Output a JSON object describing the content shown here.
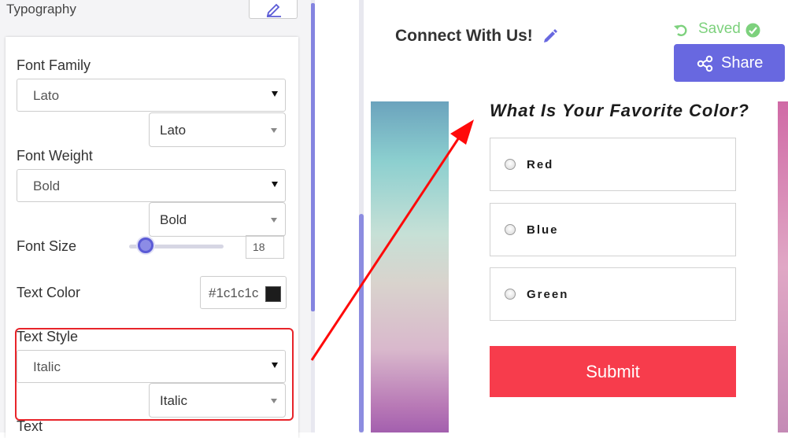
{
  "sidebar": {
    "section_title": "Typography",
    "font_family": {
      "label": "Font Family",
      "value": "Lato",
      "sub_value": "Lato"
    },
    "font_weight": {
      "label": "Font Weight",
      "value": "Bold",
      "sub_value": "Bold"
    },
    "font_size": {
      "label": "Font Size",
      "value": "18"
    },
    "text_color": {
      "label": "Text Color",
      "value": "#1c1c1c",
      "swatch": "#1c1c1c"
    },
    "text_style": {
      "label": "Text Style",
      "value": "Italic",
      "sub_value": "Italic"
    },
    "next_label": "Text"
  },
  "preview": {
    "title": "Connect With Us!",
    "saved_label": "Saved",
    "share_label": "Share",
    "question": "What Is Your Favorite Color?",
    "options": [
      "Red",
      "Blue",
      "Green"
    ],
    "submit_label": "Submit"
  },
  "icons": {
    "edit": "pencil-icon",
    "undo": "undo-icon",
    "check": "check-circle-icon",
    "share": "share-icon"
  },
  "colors": {
    "accent": "#6868e0",
    "submit": "#f73c4c",
    "saved": "#7dd17d",
    "highlight": "#e8242a"
  }
}
